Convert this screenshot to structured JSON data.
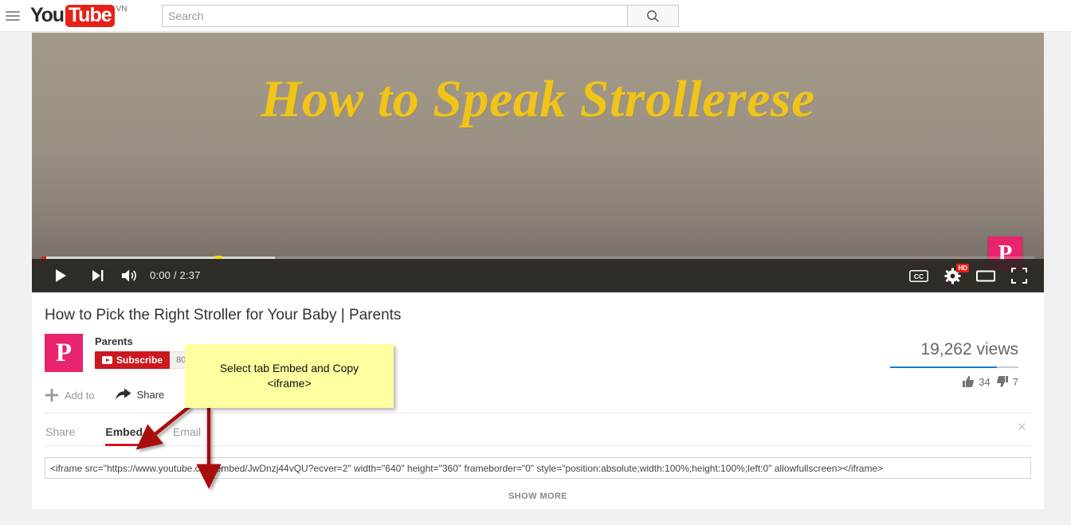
{
  "masthead": {
    "guide_icon": "hamburger-menu-icon",
    "logo_you": "You",
    "logo_tube": "Tube",
    "country_code": "VN",
    "search": {
      "placeholder": "Search",
      "value": "",
      "button_icon": "search-icon"
    }
  },
  "player": {
    "video_art_title": "How to Speak Strollerese",
    "watermark_letter": "P",
    "controls": {
      "play_icon": "play-icon",
      "next_icon": "next-track-icon",
      "volume_icon": "volume-icon",
      "time": "0:00 / 2:37",
      "current_time": "0:00",
      "duration": "2:37",
      "cc_label": "CC",
      "settings_icon": "gear-icon",
      "quality_badge": "HD",
      "theater_icon": "theater-mode-icon",
      "fullscreen_icon": "fullscreen-icon"
    },
    "progress": {
      "played_percent": 0.5,
      "loaded_percent": 23.5,
      "marker_percent": 17.5,
      "played_color": "#e62117",
      "marker_color": "#ffd500"
    }
  },
  "video": {
    "title": "How to Pick the Right Stroller for Your Baby | Parents",
    "channel_name": "Parents",
    "channel_avatar_letter": "P",
    "subscribe_label": "Subscribe",
    "subscriber_count": "80K",
    "view_count": "19,262 views",
    "likes": "34",
    "dislikes": "7",
    "like_icon": "thumbs-up-icon",
    "dislike_icon": "thumbs-down-icon",
    "rating_percent": 83,
    "actions": {
      "add_to_label": "Add to",
      "add_to_icon": "plus-icon",
      "share_label": "Share",
      "share_icon": "share-arrow-icon",
      "more_label": "•••"
    }
  },
  "share_panel": {
    "tabs": [
      {
        "label": "Share",
        "active": false
      },
      {
        "label": "Embed",
        "active": true
      },
      {
        "label": "Email",
        "active": false
      }
    ],
    "close_icon": "close-icon",
    "embed_code": "<iframe src=\"https://www.youtube.com/embed/JwDnzj44vQU?ecver=2\" width=\"640\" height=\"360\" frameborder=\"0\" style=\"position:absolute;width:100%;height:100%;left:0\" allowfullscreen></iframe>",
    "show_more_label": "SHOW MORE"
  },
  "annotation": {
    "text": "Select tab Embed and Copy <iframe>",
    "line1": "Select tab Embed and Copy",
    "line2": "<iframe>",
    "background": "#ffffa0",
    "arrow_color": "#a81010"
  }
}
